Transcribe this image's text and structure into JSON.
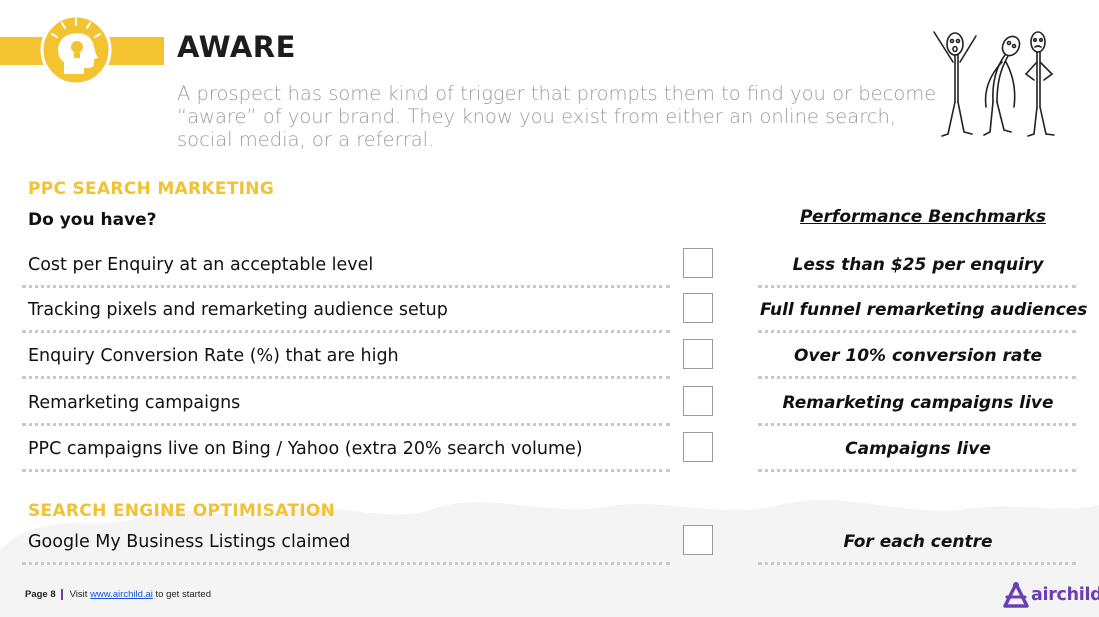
{
  "header": {
    "title": "AWARE",
    "intro": "A prospect has some kind of trigger that prompts them to find you or become “aware” of your brand. They know you exist from either an online search, social media, or a referral.",
    "icon": "head-lightbulb-icon",
    "illustration": "stick-figures-illustration"
  },
  "colors": {
    "accent": "#f4c430",
    "heading": "#f2c233",
    "brand": "#6a3fb5"
  },
  "ppc": {
    "heading": "PPC SEARCH MARKETING",
    "question": "Do you have?",
    "benchmarks_header": "Performance Benchmarks",
    "rows": [
      {
        "item": "Cost per Enquiry at an acceptable level",
        "benchmark": "Less than $25 per enquiry"
      },
      {
        "item": "Tracking pixels and remarketing audience setup",
        "benchmark": "Full funnel remarketing audiences"
      },
      {
        "item": "Enquiry Conversion Rate (%) that are high",
        "benchmark": "Over 10% conversion rate"
      },
      {
        "item": "Remarketing campaigns",
        "benchmark": "Remarketing campaigns live"
      },
      {
        "item": "PPC campaigns live on Bing / Yahoo (extra 20% search volume)",
        "benchmark": "Campaigns live"
      }
    ]
  },
  "seo": {
    "heading": "SEARCH ENGINE OPTIMISATION",
    "rows": [
      {
        "item": "Google My Business Listings claimed",
        "benchmark": "For each centre"
      }
    ]
  },
  "footer": {
    "page": "Page 8",
    "visit": "Visit",
    "link": "www.airchild.ai",
    "after": "to get started",
    "brand": "airchild"
  }
}
